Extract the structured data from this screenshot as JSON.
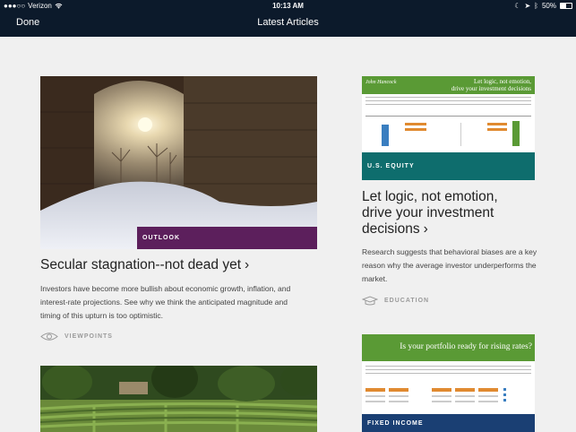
{
  "status_bar": {
    "carrier": "Verizon",
    "time": "10:13 AM",
    "battery": "50%"
  },
  "nav": {
    "done_label": "Done",
    "title": "Latest Articles"
  },
  "articles": [
    {
      "category": "OUTLOOK",
      "headline": "Secular stagnation--not dead yet",
      "description": "Investors have become more bullish about economic growth, inflation, and interest-rate projections. See why we think the anticipated magnitude and timing of this upturn is too optimistic.",
      "tag": "VIEWPOINTS",
      "accent": "#5c1f5c"
    },
    {
      "category": "U.S. EQUITY",
      "headline_lines": [
        "Let logic, not emotion,",
        "drive your investment",
        "decisions"
      ],
      "description": "Research suggests that behavioral biases are a key reason why the average investor underperforms the market.",
      "tag": "EDUCATION",
      "thumbnail_title_lines": [
        "Let logic, not emotion,",
        "drive your investment decisions"
      ],
      "accent": "#0e6d6d"
    },
    {
      "category": "FIXED INCOME",
      "thumbnail_title": "Is your portfolio ready for rising rates?",
      "accent": "#1a3f73"
    }
  ],
  "colors": {
    "nav_bg": "#0c1a2b",
    "page_bg": "#f0f0f0",
    "thumb_green": "#5a9a35"
  }
}
